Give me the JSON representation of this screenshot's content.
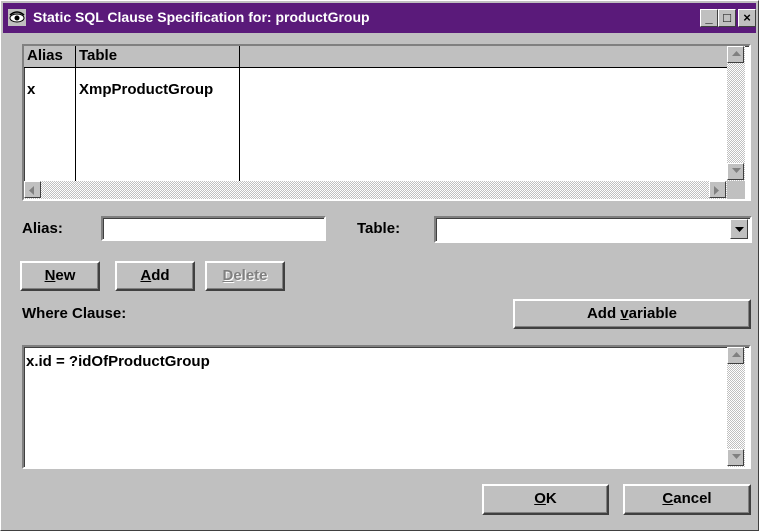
{
  "window": {
    "title": "Static SQL Clause Specification for: productGroup",
    "minimize": "_",
    "maximize": "□",
    "close": "×"
  },
  "table": {
    "columns": [
      "Alias",
      "Table"
    ],
    "rows": [
      {
        "alias": "x",
        "table": "XmpProductGroup"
      }
    ]
  },
  "form": {
    "alias_label": "Alias:",
    "alias_value": "",
    "table_label": "Table:",
    "table_value": ""
  },
  "buttons": {
    "new_pre": "",
    "new_key": "N",
    "new_post": "ew",
    "add_pre": "",
    "add_key": "A",
    "add_post": "dd",
    "delete_pre": "",
    "delete_key": "D",
    "delete_post": "elete",
    "add_variable_pre": "Add ",
    "add_variable_key": "v",
    "add_variable_post": "ariable",
    "ok_pre": "",
    "ok_key": "O",
    "ok_post": "K",
    "cancel_pre": "",
    "cancel_key": "C",
    "cancel_post": "ancel"
  },
  "where": {
    "label": "Where Clause:",
    "text": "x.id = ?idOfProductGroup"
  },
  "icons": [
    "eye-icon",
    "scroll-up-icon",
    "scroll-down-icon",
    "scroll-left-icon",
    "scroll-right-icon",
    "dropdown-arrow-icon"
  ],
  "colors": {
    "titlebar": "#5a1a7a",
    "face": "#c0c0c0"
  }
}
